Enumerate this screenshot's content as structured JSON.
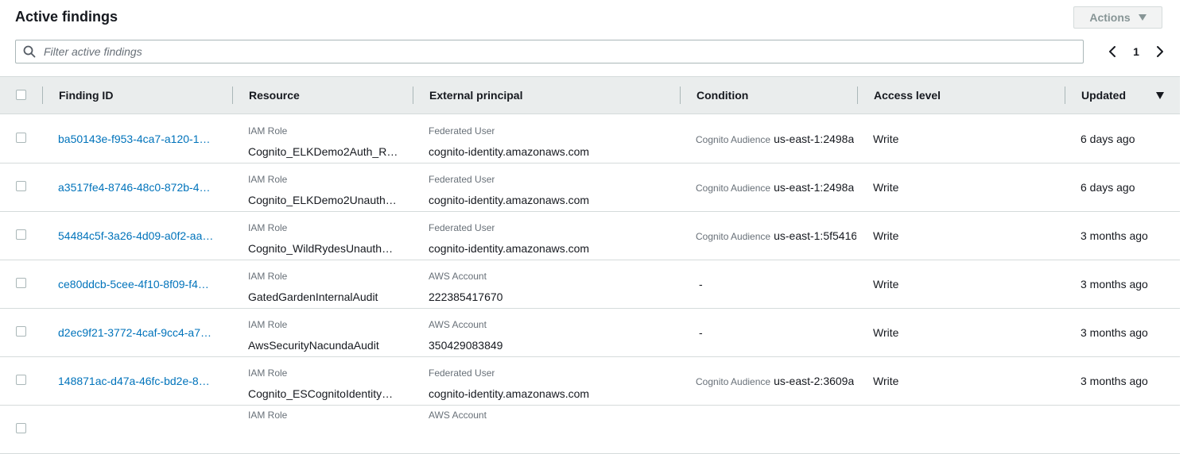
{
  "header": {
    "title": "Active findings",
    "actions_label": "Actions"
  },
  "search": {
    "placeholder": "Filter active findings"
  },
  "pagination": {
    "current_page": "1"
  },
  "table": {
    "columns": [
      "Finding ID",
      "Resource",
      "External principal",
      "Condition",
      "Access level",
      "Updated"
    ],
    "rows": [
      {
        "finding_id": "ba50143e-f953-4ca7-a120-1…",
        "resource_type": "IAM Role",
        "resource_name": "Cognito_ELKDemo2Auth_R…",
        "principal_type": "Federated User",
        "principal_value": "cognito-identity.amazonaws.com",
        "condition_key": "Cognito Audience",
        "condition_value": "us-east-1:2498a",
        "access_level": "Write",
        "updated": "6 days ago"
      },
      {
        "finding_id": "a3517fe4-8746-48c0-872b-4…",
        "resource_type": "IAM Role",
        "resource_name": "Cognito_ELKDemo2Unauth…",
        "principal_type": "Federated User",
        "principal_value": "cognito-identity.amazonaws.com",
        "condition_key": "Cognito Audience",
        "condition_value": "us-east-1:2498a",
        "access_level": "Write",
        "updated": "6 days ago"
      },
      {
        "finding_id": "54484c5f-3a26-4d09-a0f2-aa…",
        "resource_type": "IAM Role",
        "resource_name": "Cognito_WildRydesUnauth…",
        "principal_type": "Federated User",
        "principal_value": "cognito-identity.amazonaws.com",
        "condition_key": "Cognito Audience",
        "condition_value": "us-east-1:5f5416",
        "access_level": "Write",
        "updated": "3 months ago"
      },
      {
        "finding_id": "ce80ddcb-5cee-4f10-8f09-f4…",
        "resource_type": "IAM Role",
        "resource_name": "GatedGardenInternalAudit",
        "principal_type": "AWS Account",
        "principal_value": "222385417670",
        "condition_key": "",
        "condition_value": "-",
        "access_level": "Write",
        "updated": "3 months ago"
      },
      {
        "finding_id": "d2ec9f21-3772-4caf-9cc4-a7…",
        "resource_type": "IAM Role",
        "resource_name": "AwsSecurityNacundaAudit",
        "principal_type": "AWS Account",
        "principal_value": "350429083849",
        "condition_key": "",
        "condition_value": "-",
        "access_level": "Write",
        "updated": "3 months ago"
      },
      {
        "finding_id": "148871ac-d47a-46fc-bd2e-8…",
        "resource_type": "IAM Role",
        "resource_name": "Cognito_ESCognitoIdentity…",
        "principal_type": "Federated User",
        "principal_value": "cognito-identity.amazonaws.com",
        "condition_key": "Cognito Audience",
        "condition_value": "us-east-2:3609a",
        "access_level": "Write",
        "updated": "3 months ago"
      },
      {
        "finding_id": "",
        "resource_type": "IAM Role",
        "resource_name": "",
        "principal_type": "AWS Account",
        "principal_value": "",
        "condition_key": "",
        "condition_value": "",
        "access_level": "",
        "updated": ""
      }
    ]
  },
  "colors": {
    "link": "#0073bb",
    "header_bg": "#eaeded",
    "border": "#d5dbdb"
  }
}
